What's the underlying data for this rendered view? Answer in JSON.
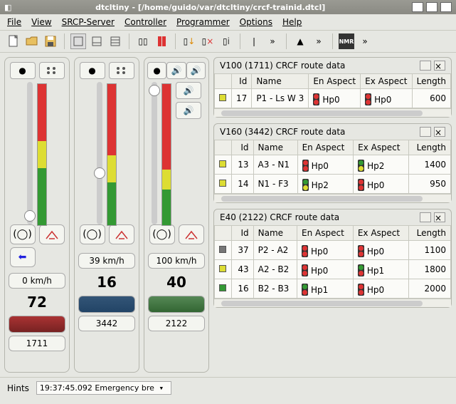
{
  "window": {
    "app": "dtcltiny",
    "path": "[/home/guido/var/dtcltiny/crcf-trainid.dtcl]"
  },
  "menu": [
    "File",
    "View",
    "SRCP-Server",
    "Controller",
    "Programmer",
    "Options",
    "Help"
  ],
  "panels": [
    {
      "speed": "0 km/h",
      "num": "72",
      "id": "1711",
      "thumb": 180,
      "red": 80,
      "yellow": 40,
      "green": 80,
      "arrow": "left",
      "loco": "red"
    },
    {
      "speed": "39 km/h",
      "num": "16",
      "id": "3442",
      "thumb": 120,
      "red": 100,
      "yellow": 40,
      "green": 60,
      "arrow": "none",
      "loco": "blue"
    },
    {
      "speed": "100 km/h",
      "num": "40",
      "id": "2122",
      "thumb": 4,
      "red": 120,
      "yellow": 30,
      "green": 50,
      "arrow": "none",
      "loco": "green",
      "speakers": true
    }
  ],
  "groups": [
    {
      "title": "V100 (1711) CRCF route data",
      "rows": [
        {
          "sq": "y",
          "id": 17,
          "name": "P1 - Ls W 3",
          "en": {
            "d": [
              "r",
              "r"
            ],
            "t": "Hp0"
          },
          "ex": {
            "d": [
              "r",
              "r"
            ],
            "t": "Hp0"
          },
          "len": 600
        }
      ]
    },
    {
      "title": "V160 (3442) CRCF route data",
      "rows": [
        {
          "sq": "y",
          "id": 13,
          "name": "A3 - N1",
          "en": {
            "d": [
              "r",
              "r"
            ],
            "t": "Hp0"
          },
          "ex": {
            "d": [
              "g",
              "y"
            ],
            "t": "Hp2"
          },
          "len": 1400
        },
        {
          "sq": "y",
          "id": 14,
          "name": "N1 - F3",
          "en": {
            "d": [
              "g",
              "y"
            ],
            "t": "Hp2"
          },
          "ex": {
            "d": [
              "r",
              "r"
            ],
            "t": "Hp0"
          },
          "len": 950
        }
      ]
    },
    {
      "title": "E40 (2122) CRCF route data",
      "rows": [
        {
          "sq": "gr",
          "id": 37,
          "name": "P2 - A2",
          "en": {
            "d": [
              "r",
              "r"
            ],
            "t": "Hp0"
          },
          "ex": {
            "d": [
              "r",
              "r"
            ],
            "t": "Hp0"
          },
          "len": 1100
        },
        {
          "sq": "y",
          "id": 43,
          "name": "A2 - B2",
          "en": {
            "d": [
              "r",
              "r"
            ],
            "t": "Hp0"
          },
          "ex": {
            "d": [
              "g",
              "r"
            ],
            "t": "Hp1"
          },
          "len": 1800
        },
        {
          "sq": "g",
          "id": 16,
          "name": "B2 - B3",
          "en": {
            "d": [
              "g",
              "r"
            ],
            "t": "Hp1"
          },
          "ex": {
            "d": [
              "r",
              "r"
            ],
            "t": "Hp0"
          },
          "len": 2000
        }
      ]
    }
  ],
  "cols": {
    "id": "Id",
    "name": "Name",
    "en": "En Aspect",
    "ex": "Ex Aspect",
    "len": "Length"
  },
  "status": {
    "label": "Hints",
    "msg": "19:37:45.092 Emergency bre"
  }
}
